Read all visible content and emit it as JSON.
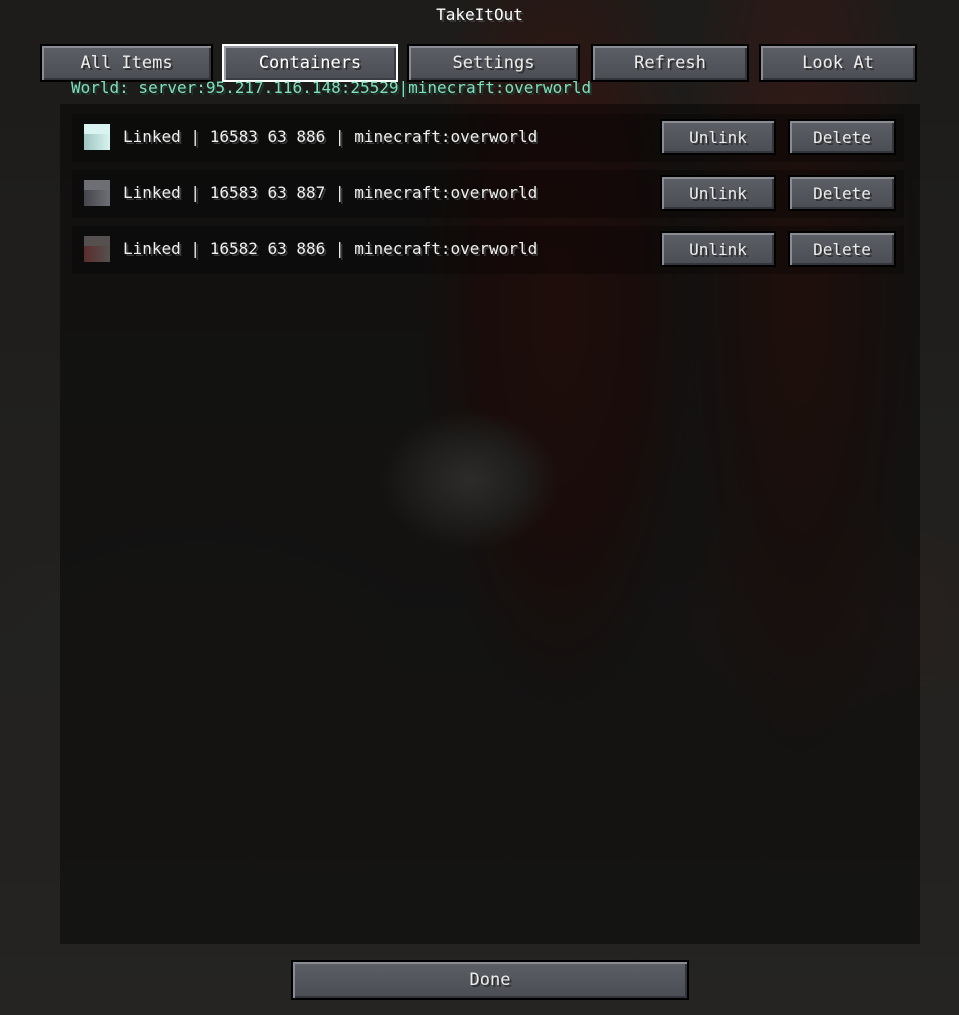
{
  "window": {
    "title": "TakeItOut"
  },
  "tabs": [
    {
      "label": "All Items",
      "active": false
    },
    {
      "label": "Containers",
      "active": true
    },
    {
      "label": "Settings",
      "active": false
    },
    {
      "label": "Refresh",
      "active": false
    },
    {
      "label": "Look At",
      "active": false
    }
  ],
  "world_info": "World: server:95.217.116.148:25529|minecraft:overworld",
  "containers": [
    {
      "icon": "diamond-block-icon",
      "label": "Linked | 16583 63 886 | minecraft:overworld",
      "unlink_label": "Unlink",
      "delete_label": "Delete",
      "icon_colors": {
        "top": "#d8f3f0",
        "side": "#9fc6c2"
      }
    },
    {
      "icon": "chest-block-icon",
      "label": "Linked | 16583 63 887 | minecraft:overworld",
      "unlink_label": "Unlink",
      "delete_label": "Delete",
      "icon_colors": {
        "top": "#6d6f75",
        "side": "#44464b"
      }
    },
    {
      "icon": "barrel-block-icon",
      "label": "Linked | 16582 63 886 | minecraft:overworld",
      "unlink_label": "Unlink",
      "delete_label": "Delete",
      "icon_colors": {
        "top": "#55504f",
        "side": "#5a2e2c"
      }
    }
  ],
  "footer": {
    "done_label": "Done"
  },
  "colors": {
    "world_info": "#7fe2bd",
    "button_face": "#55575e",
    "active_border": "#ffffff"
  }
}
